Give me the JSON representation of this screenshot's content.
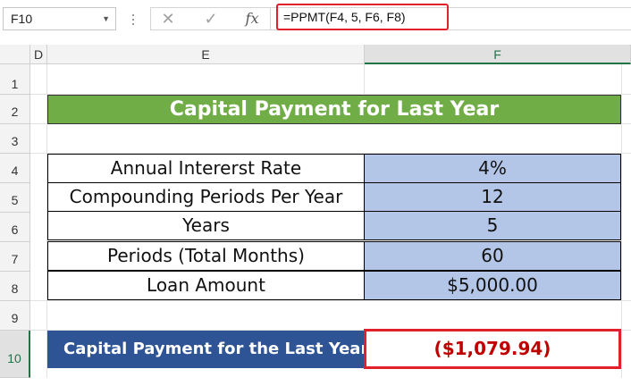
{
  "formula_bar": {
    "name_box": "F10",
    "cancel_glyph": "✕",
    "enter_glyph": "✓",
    "fx_glyph": "fx",
    "formula": "=PPMT(F4, 5, F6, F8)"
  },
  "columns": [
    "D",
    "E",
    "F"
  ],
  "rows": [
    "1",
    "2",
    "3",
    "4",
    "5",
    "6",
    "7",
    "8",
    "9",
    "10"
  ],
  "table": {
    "title": "Capital Payment for Last Year",
    "items": [
      {
        "label": "Annual Intererst Rate",
        "value": "4%"
      },
      {
        "label": "Compounding Periods Per Year",
        "value": "12"
      },
      {
        "label": "Years",
        "value": "5"
      },
      {
        "label": "Periods (Total Months)",
        "value": "60"
      },
      {
        "label": "Loan Amount",
        "value": "$5,000.00"
      }
    ],
    "result_label": "Capital Payment  for the Last Year",
    "result_value": "($1,079.94)"
  },
  "colors": {
    "title_fill": "#70ad47",
    "value_fill": "#b4c6e7",
    "result_label_fill": "#2f5496",
    "highlight_border": "#e0202a",
    "result_text": "#c00000"
  }
}
